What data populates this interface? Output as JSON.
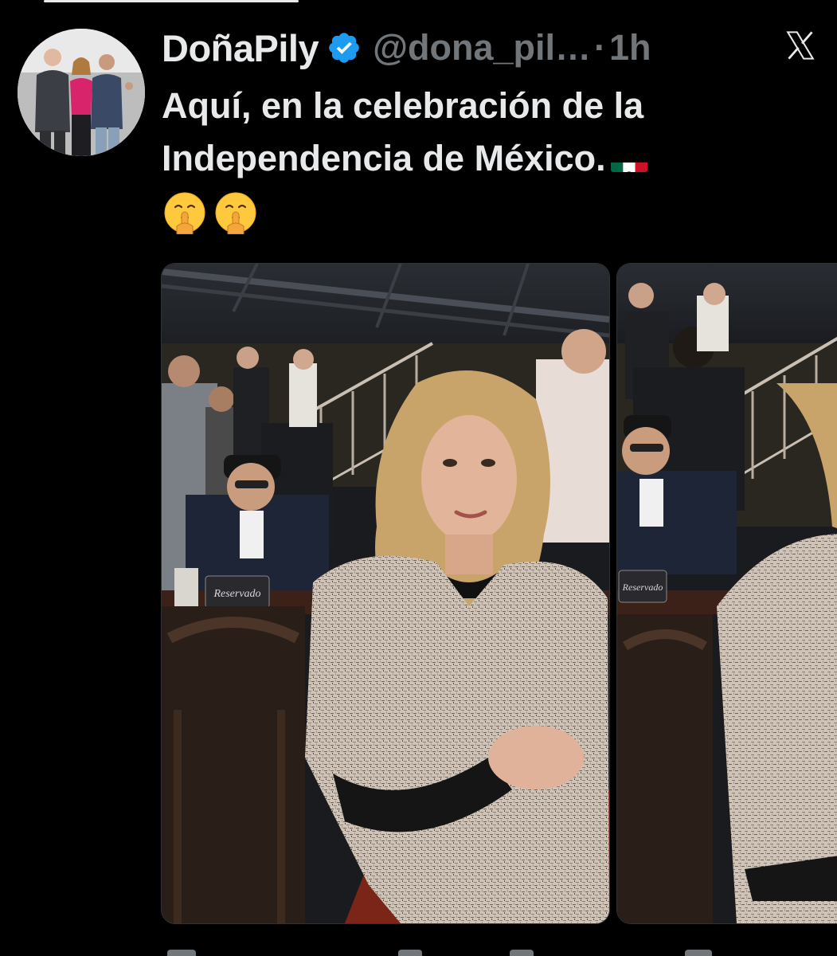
{
  "tweet": {
    "display_name": "DoñaPily",
    "handle": "@dona_pil…",
    "separator": "·",
    "time": "1h",
    "text_line1": "Aquí, en la celebración de la",
    "text_line2": "Independencia de México."
  },
  "media": {
    "main_sign": "Reservado",
    "secondary_sign": "Reservado"
  },
  "icons": {
    "verified": "verified-badge-icon",
    "logo": "x-logo-icon",
    "flag": "mexico-flag-emoji",
    "emoji": "shushing-face-emoji"
  },
  "colors": {
    "background": "#000000",
    "text": "#e7e9ea",
    "muted": "#71767b",
    "verified": "#1d9bf0"
  }
}
